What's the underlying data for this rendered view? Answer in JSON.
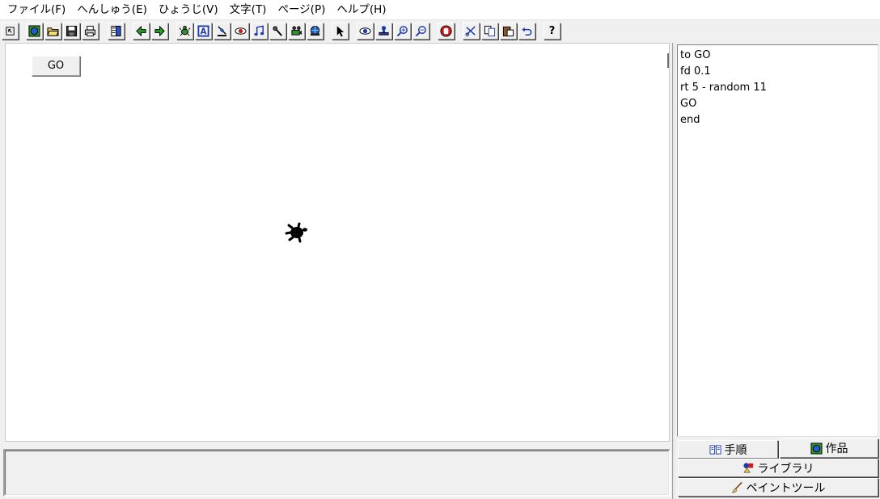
{
  "menubar": {
    "items": [
      "ファイル(F)",
      "へんしゅう(E)",
      "ひょうじ(V)",
      "文字(T)",
      "ページ(P)",
      "ヘルプ(H)"
    ]
  },
  "toolbar": {
    "text_tool_label": "A",
    "help_label": "?"
  },
  "stage": {
    "go_button_label": "GO"
  },
  "procedures": {
    "lines": [
      "to GO",
      "fd 0.1",
      "rt 5 - random 11",
      "GO",
      "end"
    ]
  },
  "tabs": {
    "procedures_label": "手順",
    "project_label": "作品",
    "library_label": "ライブラリ",
    "paint_label": "ペイントツール"
  }
}
